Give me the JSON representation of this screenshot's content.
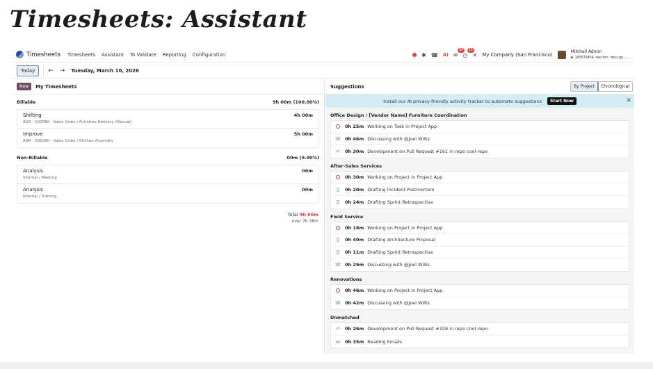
{
  "slide_title_a": "Timesheets",
  "slide_title_b": ": Assistant",
  "navbar": {
    "app_name": "Timesheets",
    "menu": [
      "Timesheets",
      "Assistant",
      "To Validate",
      "Reporting",
      "Configuration"
    ],
    "ai_label": "AI",
    "messages_badge": "34",
    "activities_badge": "21",
    "company": "My Company (San Francisco)",
    "user_name": "Mitchell Admin",
    "db_name": "103579454-master-design-..."
  },
  "controls": {
    "today_label": "Today",
    "date": "Tuesday, March 10, 2026"
  },
  "left_panel": {
    "new_label": "New",
    "title": "My Timesheets",
    "groups": [
      {
        "name": "Billable",
        "total": "9h 00m (100.00%)",
        "entries": [
          {
            "name": "Shifting",
            "sub": "AGR - S00080 - Sales Order / Furniture Delivery (Manual)",
            "duration": "4h 00m"
          },
          {
            "name": "Improve",
            "sub": "AGR - S00080 - Sales Order / Kitchen Assembly",
            "duration": "5h 00m"
          }
        ]
      },
      {
        "name": "Non-Billable",
        "total": "00m (0.00%)",
        "entries": [
          {
            "name": "Analysis",
            "sub": "Internal / Meeting",
            "duration": "00m"
          },
          {
            "name": "Analysis",
            "sub": "Internal / Training",
            "duration": "00m"
          }
        ]
      }
    ],
    "total_label": "Total",
    "total_value": "9h 00m",
    "over_text": "over 7h 36m"
  },
  "right_panel": {
    "title": "Suggestions",
    "toggle": [
      "By Project",
      "Chronological"
    ],
    "banner_text": "Install our AI privacy-friendly activity tracker to automate suggestions",
    "start_label": "Start Now",
    "groups": [
      {
        "name": "Office Design / [Vendor Name] Furniture Coordination",
        "items": [
          {
            "icon": "task-icon",
            "duration": "0h 25m",
            "desc": "Working on Task in Project App"
          },
          {
            "icon": "phone-icon",
            "duration": "0h 46m",
            "desc": "Discussing with @Joel Willis"
          },
          {
            "icon": "code-icon",
            "duration": "0h 30m",
            "desc": "Development on Pull Request #161 in repo cool-repo"
          }
        ]
      },
      {
        "name": "After-Sales Services",
        "items": [
          {
            "icon": "task-icon",
            "duration": "0h 30m",
            "desc": "Working on Project in Project App"
          },
          {
            "icon": "document-icon",
            "duration": "0h 20m",
            "desc": "Drafting Incident Postmortem"
          },
          {
            "icon": "document-icon",
            "duration": "0h 24m",
            "desc": "Drafting Sprint Retrospective"
          }
        ]
      },
      {
        "name": "Field Service",
        "items": [
          {
            "icon": "task-icon",
            "duration": "0h 18m",
            "desc": "Working on Project in Project App"
          },
          {
            "icon": "document-icon",
            "duration": "0h 40m",
            "desc": "Drafting Architecture Proposal"
          },
          {
            "icon": "document-icon",
            "duration": "0h 11m",
            "desc": "Drafting Sprint Retrospective"
          },
          {
            "icon": "phone-icon",
            "duration": "0h 29m",
            "desc": "Discussing with @Joel Willis"
          }
        ]
      },
      {
        "name": "Renovations",
        "items": [
          {
            "icon": "task-icon",
            "duration": "0h 46m",
            "desc": "Working on Project in Project App"
          },
          {
            "icon": "phone-icon",
            "duration": "0h 42m",
            "desc": "Discussing with @Joel Willis"
          }
        ]
      },
      {
        "name": "Unmatched",
        "items": [
          {
            "icon": "code-icon",
            "duration": "0h 26m",
            "desc": "Development on Pull Request #328 in repo cool-repo"
          },
          {
            "icon": "inbox-icon",
            "duration": "0h 35m",
            "desc": "Reading Emails"
          }
        ]
      }
    ]
  }
}
